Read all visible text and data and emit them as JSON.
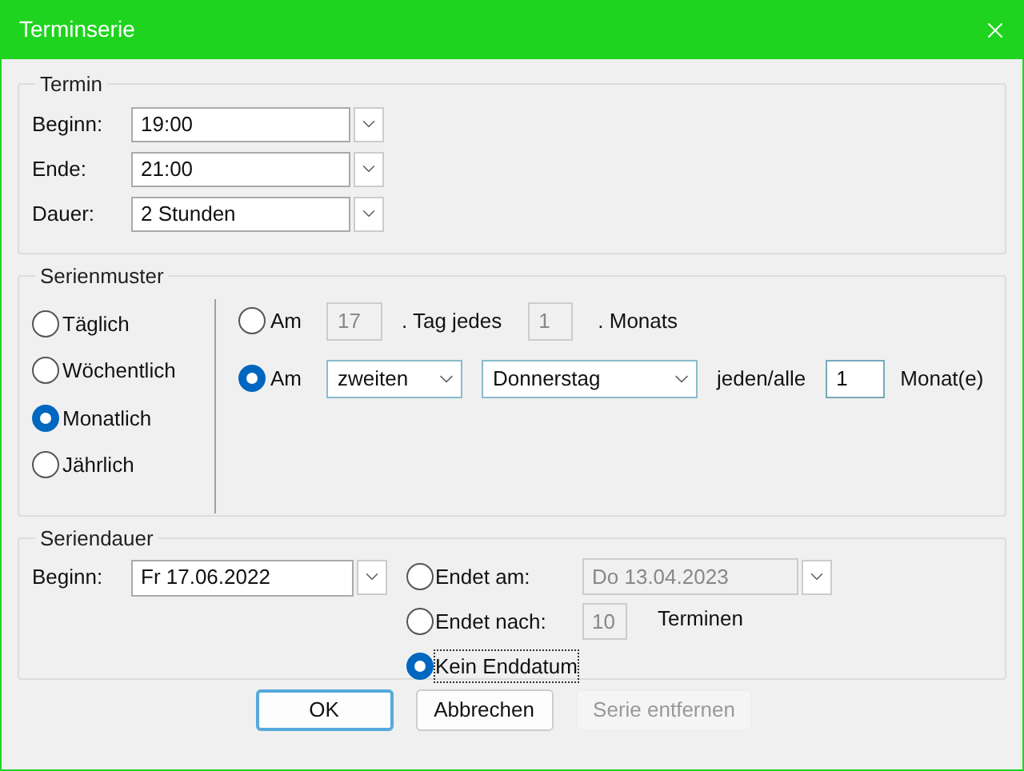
{
  "window": {
    "title": "Terminserie"
  },
  "termin": {
    "title": "Termin",
    "fields": [
      {
        "label": "Beginn:",
        "value": "19:00"
      },
      {
        "label": "Ende:",
        "value": "21:00"
      },
      {
        "label": "Dauer:",
        "value": "2 Stunden"
      }
    ]
  },
  "pattern": {
    "title": "Serienmuster",
    "types": [
      {
        "label": "Täglich",
        "selected": false
      },
      {
        "label": "Wöchentlich",
        "selected": false
      },
      {
        "label": "Monatlich",
        "selected": true
      },
      {
        "label": "Jährlich",
        "selected": false
      }
    ],
    "options": [
      {
        "kind": "day",
        "label": "Am",
        "selected": false,
        "day": "17",
        "text1": ". Tag jedes",
        "interval": "1",
        "text2": ". Monats"
      },
      {
        "kind": "weekday",
        "label": "Am",
        "selected": true,
        "ordinal": "zweiten",
        "weekday": "Donnerstag",
        "text1": "jeden/alle",
        "interval": "1",
        "text2": "Monat(e)"
      }
    ]
  },
  "duration": {
    "title": "Seriendauer",
    "start_label": "Beginn:",
    "start": "Fr 17.06.2022",
    "ends": [
      {
        "kind": "date",
        "label": "Endet am:",
        "value": "Do 13.04.2023",
        "selected": false,
        "focused": false
      },
      {
        "kind": "count",
        "label": "Endet nach:",
        "value": "10",
        "suffix": "Terminen",
        "selected": false,
        "focused": false
      },
      {
        "kind": "none",
        "label": "Kein Enddatum",
        "selected": true,
        "focused": true
      }
    ]
  },
  "buttons": [
    {
      "label": "OK",
      "default": true,
      "disabled": false
    },
    {
      "label": "Abbrechen",
      "default": false,
      "disabled": false
    },
    {
      "label": "Serie entfernen",
      "default": false,
      "disabled": true
    }
  ]
}
